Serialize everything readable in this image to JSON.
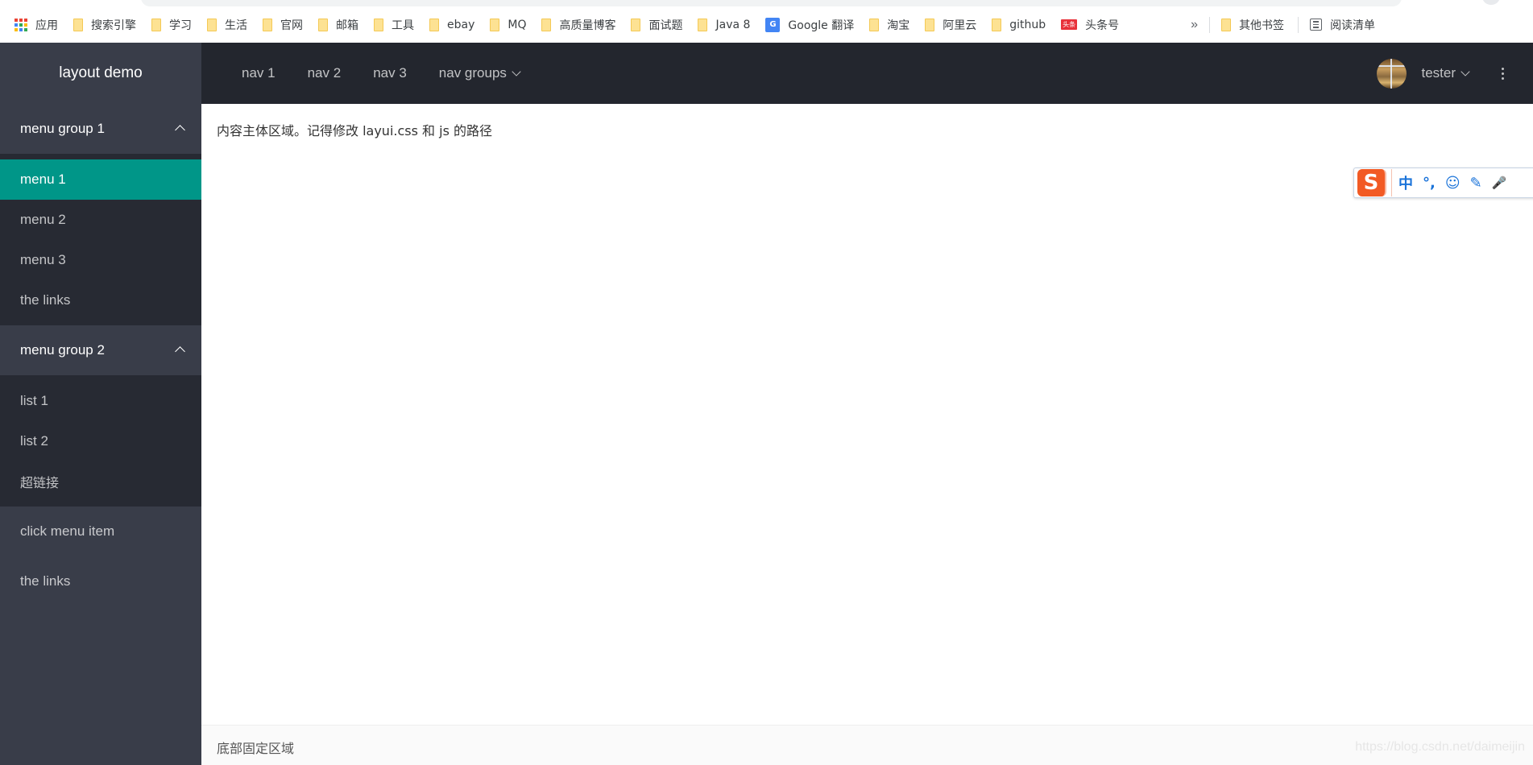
{
  "browser": {
    "bookmarks": [
      {
        "icon": "apps-icon",
        "label": "应用"
      },
      {
        "icon": "folder-icon",
        "label": "搜索引擎"
      },
      {
        "icon": "folder-icon",
        "label": "学习"
      },
      {
        "icon": "folder-icon",
        "label": "生活"
      },
      {
        "icon": "folder-icon",
        "label": "官网"
      },
      {
        "icon": "folder-icon",
        "label": "邮箱"
      },
      {
        "icon": "folder-icon",
        "label": "工具"
      },
      {
        "icon": "folder-icon",
        "label": "ebay"
      },
      {
        "icon": "folder-icon",
        "label": "MQ"
      },
      {
        "icon": "folder-icon",
        "label": "高质量博客"
      },
      {
        "icon": "folder-icon",
        "label": "面试题"
      },
      {
        "icon": "folder-icon",
        "label": "Java 8"
      },
      {
        "icon": "google-translate-icon",
        "label": "Google 翻译"
      },
      {
        "icon": "folder-icon",
        "label": "淘宝"
      },
      {
        "icon": "folder-icon",
        "label": "阿里云"
      },
      {
        "icon": "folder-icon",
        "label": "github"
      },
      {
        "icon": "toutiao-icon",
        "label": "头条号",
        "icon_text": "头条"
      }
    ],
    "more_label": "»",
    "other_bookmarks": "其他书签",
    "reading_list": "阅读清单"
  },
  "header": {
    "logo": "layout demo",
    "nav": [
      {
        "label": "nav 1"
      },
      {
        "label": "nav 2"
      },
      {
        "label": "nav 3"
      },
      {
        "label": "nav groups",
        "has_dropdown": true
      }
    ],
    "user": {
      "name": "tester"
    }
  },
  "sidebar": {
    "groups": [
      {
        "title": "menu group 1",
        "expanded": true,
        "items": [
          {
            "label": "menu 1",
            "active": true
          },
          {
            "label": "menu 2"
          },
          {
            "label": "menu 3"
          },
          {
            "label": "the links"
          }
        ]
      },
      {
        "title": "menu group 2",
        "expanded": true,
        "items": [
          {
            "label": "list 1"
          },
          {
            "label": "list 2"
          },
          {
            "label": "超链接"
          }
        ]
      }
    ],
    "items": [
      {
        "label": "click menu item"
      },
      {
        "label": "the links"
      }
    ]
  },
  "body": {
    "text": "内容主体区域。记得修改 layui.css 和 js 的路径"
  },
  "ime_toolbar": {
    "logo": "S",
    "buttons": [
      "中",
      "°,",
      "☺",
      "✎",
      "🎤"
    ]
  },
  "footer": {
    "text": "底部固定区域",
    "watermark": "https://blog.csdn.net/daimeijin"
  },
  "colors": {
    "header_bg": "#23262e",
    "sidebar_bg": "#393d49",
    "active_item": "#009688"
  }
}
